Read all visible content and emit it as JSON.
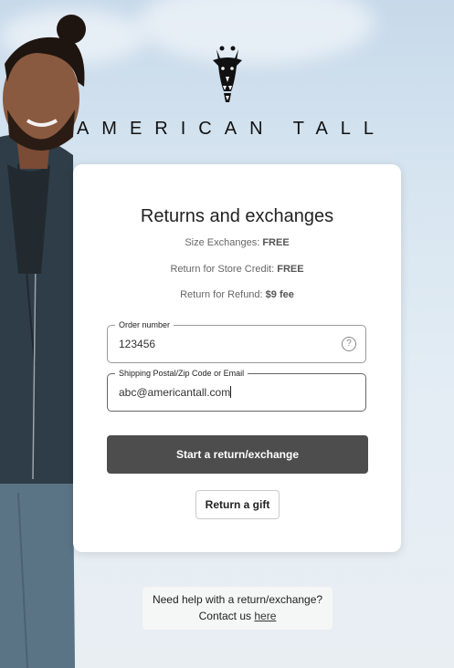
{
  "brand": {
    "name": "AMERICAN TALL"
  },
  "card": {
    "title": "Returns and exchanges",
    "policies": [
      {
        "label": "Size Exchanges:",
        "value": "FREE"
      },
      {
        "label": "Return for Store Credit:",
        "value": "FREE"
      },
      {
        "label": "Return for Refund:",
        "value": "$9 fee"
      }
    ],
    "order_field": {
      "label": "Order number",
      "value": "123456",
      "help_icon": "question-circle-icon"
    },
    "email_field": {
      "label": "Shipping Postal/Zip Code or Email",
      "value": "abc@americantall.com"
    },
    "primary_button": "Start a return/exchange",
    "gift_button": "Return a gift"
  },
  "help": {
    "line1": "Need help with a return/exchange?",
    "contact_prefix": "Contact us",
    "link_text": "here"
  },
  "colors": {
    "primary_button": "#4d4d4d",
    "card_bg": "#ffffff"
  }
}
